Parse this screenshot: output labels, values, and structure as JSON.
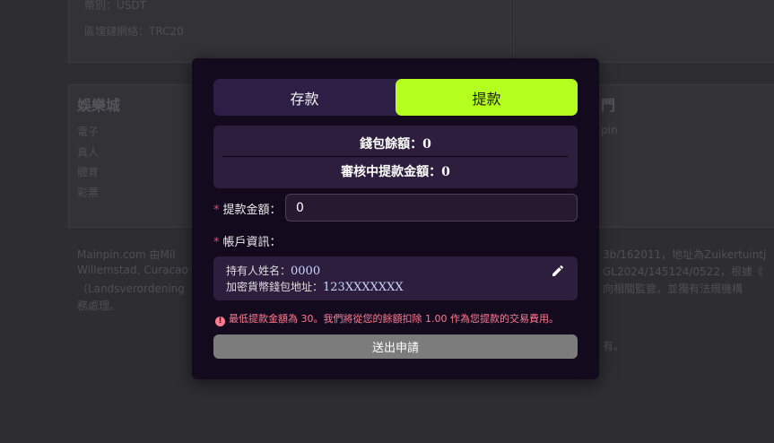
{
  "background": {
    "top_card": {
      "lines": [
        "幣別：USDT",
        "區塊鏈網絡：TRC20"
      ]
    },
    "left_card": {
      "heading": "娛樂城",
      "items": [
        "電子",
        "真人",
        "體育",
        "彩票"
      ]
    },
    "right_card": {
      "heading": "門",
      "items": [
        "pin",
        "",
        "",
        ""
      ]
    },
    "footer_left": [
      "Mainpin.com 由Mil",
      "Willemstad, Curacao",
      "（Landsverordening",
      "務處理。"
    ],
    "footer_right": [
      "3b/162011，地址為Zuikertuintj",
      "GL2024/145124/0522，根據《",
      "向相關監管。並獨有法規機構",
      "有。"
    ]
  },
  "modal": {
    "tabs": [
      {
        "label": "存款",
        "active": false
      },
      {
        "label": "提款",
        "active": true
      }
    ],
    "wallet_balance": "錢包餘額：0",
    "pending_withdrawal": "審核中提款金額：0",
    "amount": {
      "label": "提款金額：",
      "required_mark": "*",
      "value": "0"
    },
    "account": {
      "label": "帳戶資訊：",
      "required_mark": "*",
      "holder_label": "持有人姓名：",
      "holder_value": "0000",
      "wallet_label": "加密貨幣錢包地址：",
      "wallet_value": "123XXXXXXX"
    },
    "notice": "最低提款金額為 30。我們將從您的餘額扣除 1.00 作為您提款的交易費用。",
    "submit_label": "送出申請"
  },
  "colors": {
    "accent": "#b5ff1f",
    "modal_bg": "#140a1e",
    "panel_bg": "#2d1e3d",
    "notice": "#ff7a93",
    "button_disabled": "#7c7c7c"
  },
  "icons": {
    "edit": "pencil-icon",
    "notice": "info-circle-icon"
  }
}
